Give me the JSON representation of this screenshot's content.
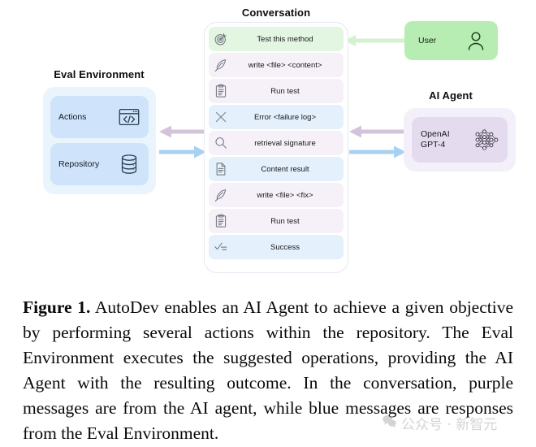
{
  "figure": {
    "eval_environment": {
      "title": "Eval Environment",
      "cards": [
        {
          "label": "Actions",
          "icon": "code-window-icon"
        },
        {
          "label": "Repository",
          "icon": "database-icon"
        }
      ],
      "box_color": "#eaf4fd",
      "card_color": "#cfe4fa"
    },
    "conversation": {
      "title": "Conversation",
      "messages": [
        {
          "text": "Test this method",
          "icon": "target-icon",
          "source": "user",
          "color": "#e3f6e1"
        },
        {
          "text": "write <file> <content>",
          "icon": "quill-icon",
          "source": "ai-agent",
          "color": "#f6f1f8"
        },
        {
          "text": "Run test",
          "icon": "clipboard-icon",
          "source": "ai-agent",
          "color": "#f6f1f8"
        },
        {
          "text": "Error <failure log>",
          "icon": "cross-icon",
          "source": "environment",
          "color": "#e4f0fb"
        },
        {
          "text": "retrieval signature",
          "icon": "magnifier-icon",
          "source": "ai-agent",
          "color": "#f6f1f8"
        },
        {
          "text": "Content result",
          "icon": "document-icon",
          "source": "environment",
          "color": "#e4f0fb"
        },
        {
          "text": "write <file> <fix>",
          "icon": "quill-icon",
          "source": "ai-agent",
          "color": "#f6f1f8"
        },
        {
          "text": "Run test",
          "icon": "clipboard-icon",
          "source": "ai-agent",
          "color": "#f6f1f8"
        },
        {
          "text": "Success",
          "icon": "checklist-icon",
          "source": "environment",
          "color": "#e4f0fb"
        }
      ]
    },
    "ai_agent": {
      "title": "AI Agent",
      "model_label": "OpenAI\nGPT-4",
      "icon": "neural-network-icon",
      "box_color": "#f4f0fa",
      "card_color": "#e4dcee"
    },
    "user": {
      "label": "User",
      "icon": "person-icon",
      "box_color": "#b7ecb2"
    },
    "arrows": [
      {
        "name": "user-to-conversation",
        "direction": "left",
        "color": "#d4f2d0"
      },
      {
        "name": "agent-to-conversation",
        "direction": "left",
        "color": "#d3c4dc"
      },
      {
        "name": "conversation-to-agent",
        "direction": "right",
        "color": "#a8d1f2"
      },
      {
        "name": "conversation-to-eval",
        "direction": "left",
        "color": "#d3c4dc"
      },
      {
        "name": "eval-to-conversation",
        "direction": "right",
        "color": "#a8d1f2"
      }
    ]
  },
  "caption": {
    "label": "Figure 1.",
    "text": " AutoDev enables an AI Agent to achieve a given objective by performing several actions within the repository. The Eval Environment executes the suggested operations, providing the AI Agent with the resulting outcome. In the conversation, purple messages are from the AI agent, while blue messages are responses from the Eval Environment."
  },
  "watermark": {
    "text": "公众号 · 新智元",
    "icon": "wechat-icon"
  }
}
